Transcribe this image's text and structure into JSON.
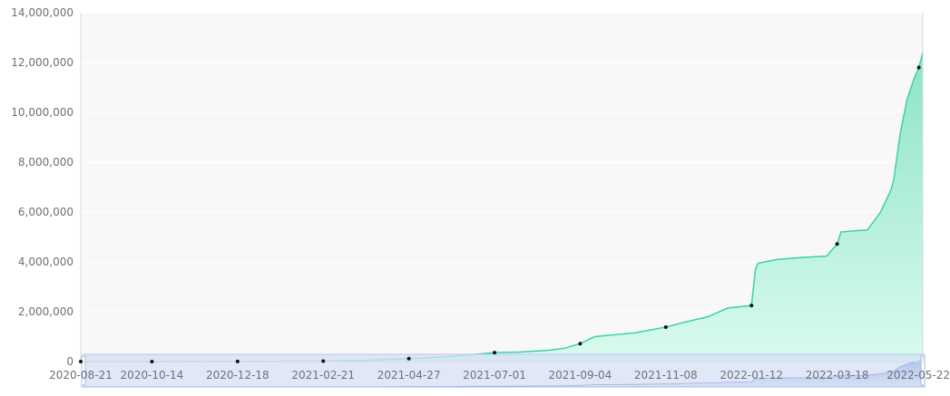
{
  "colors": {
    "background": "#ffffff",
    "plot_background": "#f8f8f8",
    "grid": "#ffffff",
    "axis": "#d8d8d8",
    "line": "#3fd39a",
    "area_top": "#8de4c6",
    "area_bottom": "#d9fbee",
    "marker": "#111111",
    "zoom_band": "#d6e0f5",
    "zoom_border": "#b8c6e8",
    "tick_text": "#6e7079"
  },
  "chart_data": {
    "type": "area",
    "title": "",
    "xlabel": "",
    "ylabel": "",
    "x_start": "2020-08-21",
    "x_end": "2022-05-22",
    "ylim": [
      0,
      14000000
    ],
    "yticks": [
      0,
      2000000,
      4000000,
      6000000,
      8000000,
      10000000,
      12000000,
      14000000
    ],
    "ytick_labels": [
      "0",
      "2,000,000",
      "4,000,000",
      "6,000,000",
      "8,000,000",
      "10,000,000",
      "12,000,000",
      "14,000,000"
    ],
    "xtick_dates": [
      "2020-08-21",
      "2020-10-14",
      "2020-12-18",
      "2021-02-21",
      "2021-04-27",
      "2021-07-01",
      "2021-09-04",
      "2021-11-08",
      "2022-01-12",
      "2022-03-18",
      "2022-05-22"
    ],
    "xtick_labels": [
      "2020-08-21",
      "2020-10-14",
      "2020-12-18",
      "2021-02-21",
      "2021-04-27",
      "2021-07-01",
      "2021-09-04",
      "2021-11-08",
      "2022-01-12",
      "2022-03-18",
      "2022-05-22"
    ],
    "grid": true,
    "series": [
      {
        "x": [
          "2020-08-21",
          "2020-10-14",
          "2020-12-18",
          "2021-02-21",
          "2021-03-25",
          "2021-04-27",
          "2021-05-29",
          "2021-06-15",
          "2021-07-01",
          "2021-07-20",
          "2021-08-10",
          "2021-08-23",
          "2021-09-04",
          "2021-09-15",
          "2021-09-25",
          "2021-10-15",
          "2021-11-08",
          "2021-11-20",
          "2021-12-10",
          "2021-12-25",
          "2022-01-12",
          "2022-01-15",
          "2022-01-17",
          "2022-02-01",
          "2022-02-20",
          "2022-03-10",
          "2022-03-18",
          "2022-03-21",
          "2022-04-01",
          "2022-04-10",
          "2022-04-20",
          "2022-04-28",
          "2022-04-30",
          "2022-05-05",
          "2022-05-10",
          "2022-05-15",
          "2022-05-19",
          "2022-05-22"
        ],
        "values": [
          0,
          0,
          5000,
          20000,
          50000,
          120000,
          200000,
          280000,
          360000,
          380000,
          450000,
          530000,
          720000,
          1000000,
          1050000,
          1150000,
          1380000,
          1550000,
          1800000,
          2150000,
          2250000,
          3700000,
          3950000,
          4100000,
          4180000,
          4230000,
          4720000,
          5200000,
          5250000,
          5280000,
          6000000,
          6900000,
          7300000,
          9200000,
          10500000,
          11300000,
          11800000,
          12400000
        ]
      }
    ],
    "markers": [
      {
        "x": "2020-08-21",
        "y": 0
      },
      {
        "x": "2020-10-14",
        "y": 0
      },
      {
        "x": "2020-12-18",
        "y": 5000
      },
      {
        "x": "2021-02-21",
        "y": 20000
      },
      {
        "x": "2021-04-27",
        "y": 120000
      },
      {
        "x": "2021-07-01",
        "y": 360000
      },
      {
        "x": "2021-09-04",
        "y": 720000
      },
      {
        "x": "2021-11-08",
        "y": 1380000
      },
      {
        "x": "2022-01-12",
        "y": 2250000
      },
      {
        "x": "2022-03-18",
        "y": 4720000
      },
      {
        "x": "2022-05-19",
        "y": 11800000
      }
    ]
  }
}
